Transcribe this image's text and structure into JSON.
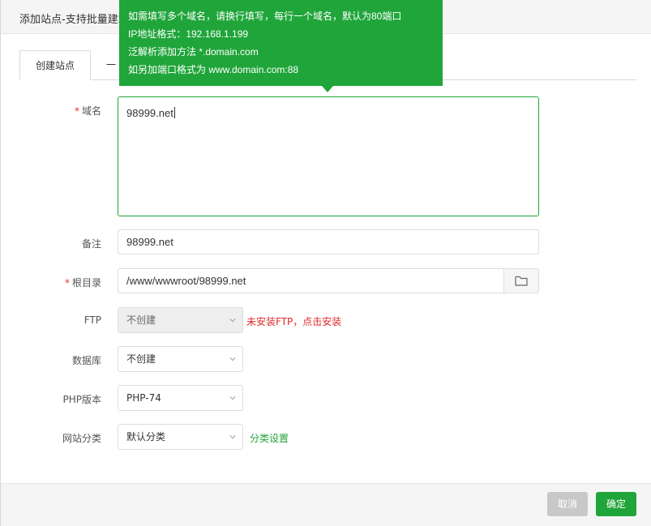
{
  "dialog": {
    "title": "添加站点-支持批量建站"
  },
  "tabs": [
    {
      "label": "创建站点"
    },
    {
      "label": "一"
    }
  ],
  "tooltip": {
    "lines": [
      "如需填写多个域名，请换行填写，每行一个域名，默认为80端口",
      "IP地址格式：192.168.1.199",
      "泛解析添加方法 *.domain.com",
      "如另加端口格式为 www.domain.com:88"
    ]
  },
  "form": {
    "domain": {
      "required_mark": "*",
      "label": "域名",
      "value": "98999.net"
    },
    "remark": {
      "label": "备注",
      "value": "98999.net"
    },
    "root": {
      "required_mark": "*",
      "label": "根目录",
      "value": "/www/wwwroot/98999.net"
    },
    "ftp": {
      "label": "FTP",
      "value": "不创建",
      "warning": "未安装FTP，点击安装"
    },
    "database": {
      "label": "数据库",
      "value": "不创建"
    },
    "php": {
      "label": "PHP版本",
      "value": "PHP-74"
    },
    "category": {
      "label": "网站分类",
      "value": "默认分类",
      "link": "分类设置"
    }
  },
  "footer": {
    "cancel_label": "取消",
    "ok_label": "确定"
  },
  "colors": {
    "accent": "#20a53a",
    "warning": "#e02a2a",
    "disabled_button": "#c8c8c8"
  },
  "icons": {
    "folder": "folder-icon",
    "chevron": "chevron-down-icon"
  }
}
